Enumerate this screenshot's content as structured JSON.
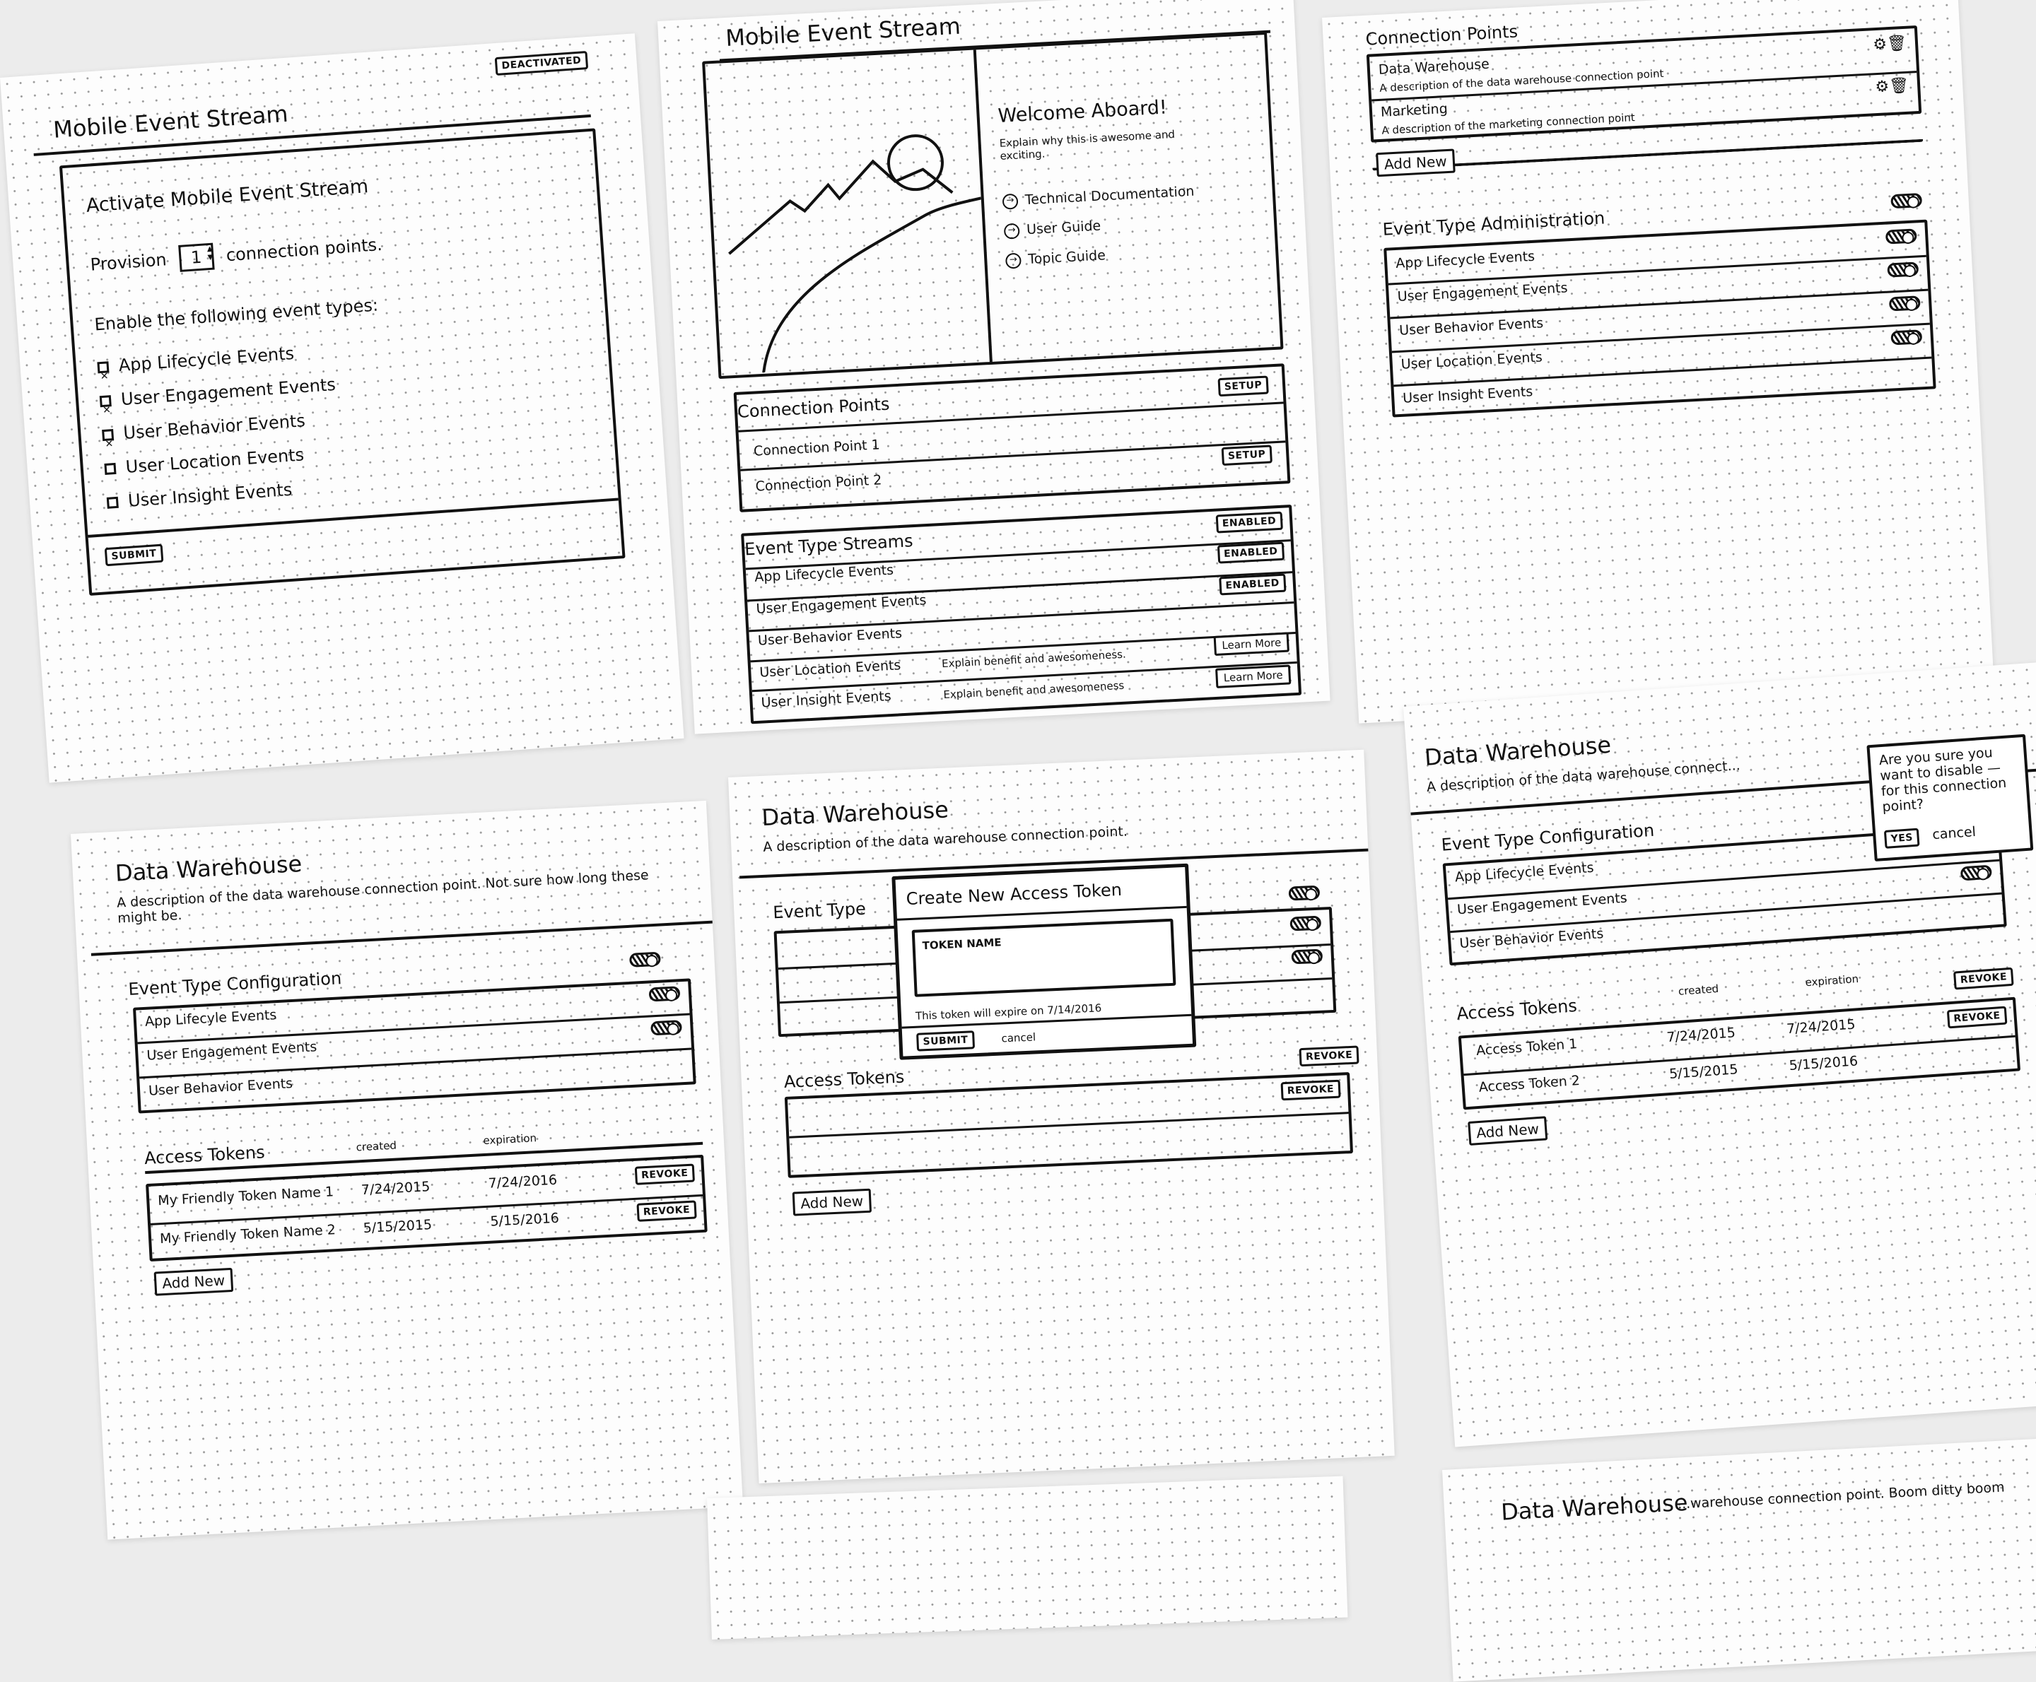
{
  "sheet1": {
    "badge": "DEACTIVATED",
    "title": "Mobile Event Stream",
    "panel_title": "Activate Mobile Event Stream",
    "provision_label": "Provision",
    "provision_value": "1",
    "provision_suffix": "connection points.",
    "enable_label": "Enable the following event types:",
    "event_types": [
      {
        "label": "App Lifecycle Events",
        "checked": true
      },
      {
        "label": "User Engagement Events",
        "checked": true
      },
      {
        "label": "User Behavior Events",
        "checked": true
      },
      {
        "label": "User Location Events",
        "checked": false
      },
      {
        "label": "User Insight Events",
        "checked": false
      }
    ],
    "submit": "SUBMIT"
  },
  "sheet2": {
    "title": "Mobile Event Stream",
    "welcome_title": "Welcome Aboard!",
    "welcome_text": "Explain why this is awesome and exciting.",
    "links": [
      "Technical Documentation",
      "User Guide",
      "Topic Guide"
    ],
    "connection_points_label": "Connection Points",
    "connection_points": [
      "Connection Point 1",
      "Connection Point 2"
    ],
    "setup": "SETUP",
    "streams_label": "Event Type Streams",
    "streams": [
      {
        "label": "App Lifecycle Events",
        "note": "",
        "action": "ENABLED"
      },
      {
        "label": "User Engagement Events",
        "note": "",
        "action": "ENABLED"
      },
      {
        "label": "User Behavior Events",
        "note": "",
        "action": "ENABLED"
      },
      {
        "label": "User Location Events",
        "note": "Explain benefit and awesomeness.",
        "action": "Learn More"
      },
      {
        "label": "User Insight Events",
        "note": "Explain benefit and awesomeness",
        "action": "Learn More"
      }
    ]
  },
  "sheet3": {
    "connection_points_label": "Connection Points",
    "connection_points": [
      {
        "name": "Data Warehouse",
        "desc": "A description of the data warehouse connection point"
      },
      {
        "name": "Marketing",
        "desc": "A description of the marketing connection point"
      }
    ],
    "add_new": "Add New",
    "admin_label": "Event Type Administration",
    "events": [
      "App Lifecycle Events",
      "User Engagement Events",
      "User Behavior Events",
      "User Location Events",
      "User Insight Events"
    ]
  },
  "sheet4": {
    "title": "Data Warehouse",
    "desc": "A description of the data warehouse connection point. Not sure how long these might be.",
    "config_label": "Event Type Configuration",
    "events": [
      "App Lifecyle Events",
      "User Engagement Events",
      "User Behavior Events"
    ],
    "tokens_label": "Access Tokens",
    "col_created": "created",
    "col_expiration": "expiration",
    "tokens": [
      {
        "name": "My Friendly Token Name 1",
        "created": "7/24/2015",
        "expiration": "7/24/2016"
      },
      {
        "name": "My Friendly Token Name 2",
        "created": "5/15/2015",
        "expiration": "5/15/2016"
      }
    ],
    "revoke": "REVOKE",
    "add_new": "Add New"
  },
  "sheet5": {
    "title": "Data Warehouse",
    "desc": "A description of the data warehouse connection point.",
    "event_type_label": "Event Type",
    "tokens_label": "Access Tokens",
    "revoke": "REVOKE",
    "add_new": "Add New",
    "modal_title": "Create New Access Token",
    "token_placeholder": "TOKEN NAME",
    "expire_note": "This token will expire on 7/14/2016",
    "submit": "SUBMIT",
    "cancel": "cancel"
  },
  "sheet6": {
    "title": "Data Warehouse",
    "desc": "A description of the data warehouse connect...",
    "config_label": "Event Type Configuration",
    "events": [
      "App Lifecycle Events",
      "User Engagement Events",
      "User Behavior Events"
    ],
    "popover_text": "Are you sure you want to disable — for this connection point?",
    "yes": "YES",
    "cancel": "cancel",
    "tokens_label": "Access Tokens",
    "col_created": "created",
    "col_expiration": "expiration",
    "tokens": [
      {
        "name": "Access Token 1",
        "created": "7/24/2015",
        "expiration": "7/24/2015"
      },
      {
        "name": "Access Token 2",
        "created": "5/15/2015",
        "expiration": "5/15/2016"
      }
    ],
    "revoke": "REVOKE",
    "add_new": "Add New"
  },
  "sheet8": {
    "title": "Data Warehouse",
    "desc": "...warehouse connection point. Boom ditty boom"
  }
}
